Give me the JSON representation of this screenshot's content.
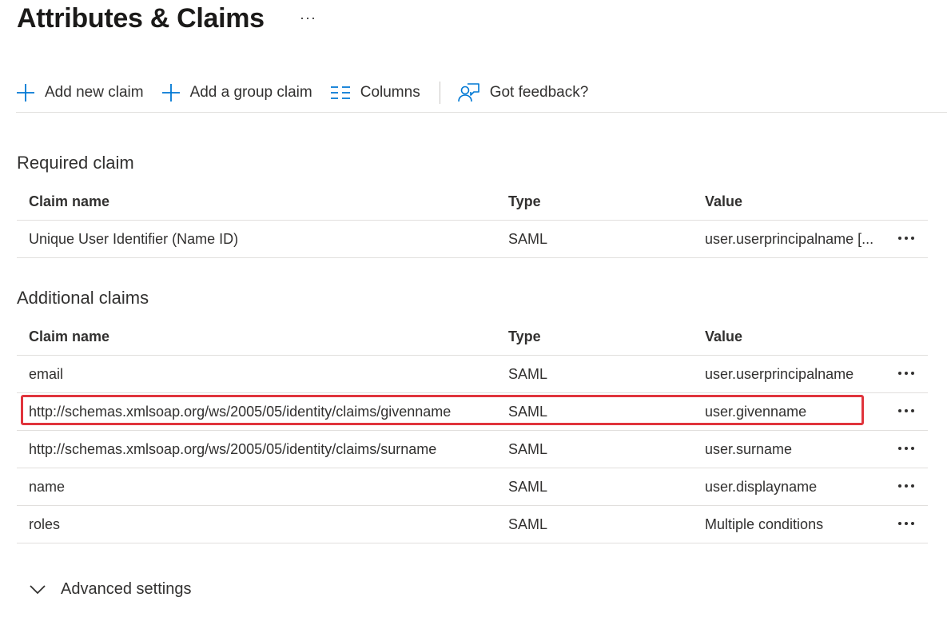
{
  "page": {
    "title": "Attributes & Claims",
    "more_label": "···"
  },
  "toolbar": {
    "add_new_claim": "Add new claim",
    "add_group_claim": "Add a group claim",
    "columns": "Columns",
    "feedback": "Got feedback?"
  },
  "required": {
    "title": "Required claim",
    "headers": {
      "name": "Claim name",
      "type": "Type",
      "value": "Value"
    },
    "rows": [
      {
        "name": "Unique User Identifier (Name ID)",
        "type": "SAML",
        "value": "user.userprincipalname [..."
      }
    ]
  },
  "additional": {
    "title": "Additional claims",
    "headers": {
      "name": "Claim name",
      "type": "Type",
      "value": "Value"
    },
    "rows": [
      {
        "name": "email",
        "type": "SAML",
        "value": "user.userprincipalname"
      },
      {
        "name": "http://schemas.xmlsoap.org/ws/2005/05/identity/claims/givenname",
        "type": "SAML",
        "value": "user.givenname"
      },
      {
        "name": "http://schemas.xmlsoap.org/ws/2005/05/identity/claims/surname",
        "type": "SAML",
        "value": "user.surname"
      },
      {
        "name": "name",
        "type": "SAML",
        "value": "user.displayname"
      },
      {
        "name": "roles",
        "type": "SAML",
        "value": "Multiple conditions"
      }
    ]
  },
  "advanced": {
    "label": "Advanced settings"
  },
  "colors": {
    "accent": "#0078d4",
    "highlight": "#e0343c"
  }
}
